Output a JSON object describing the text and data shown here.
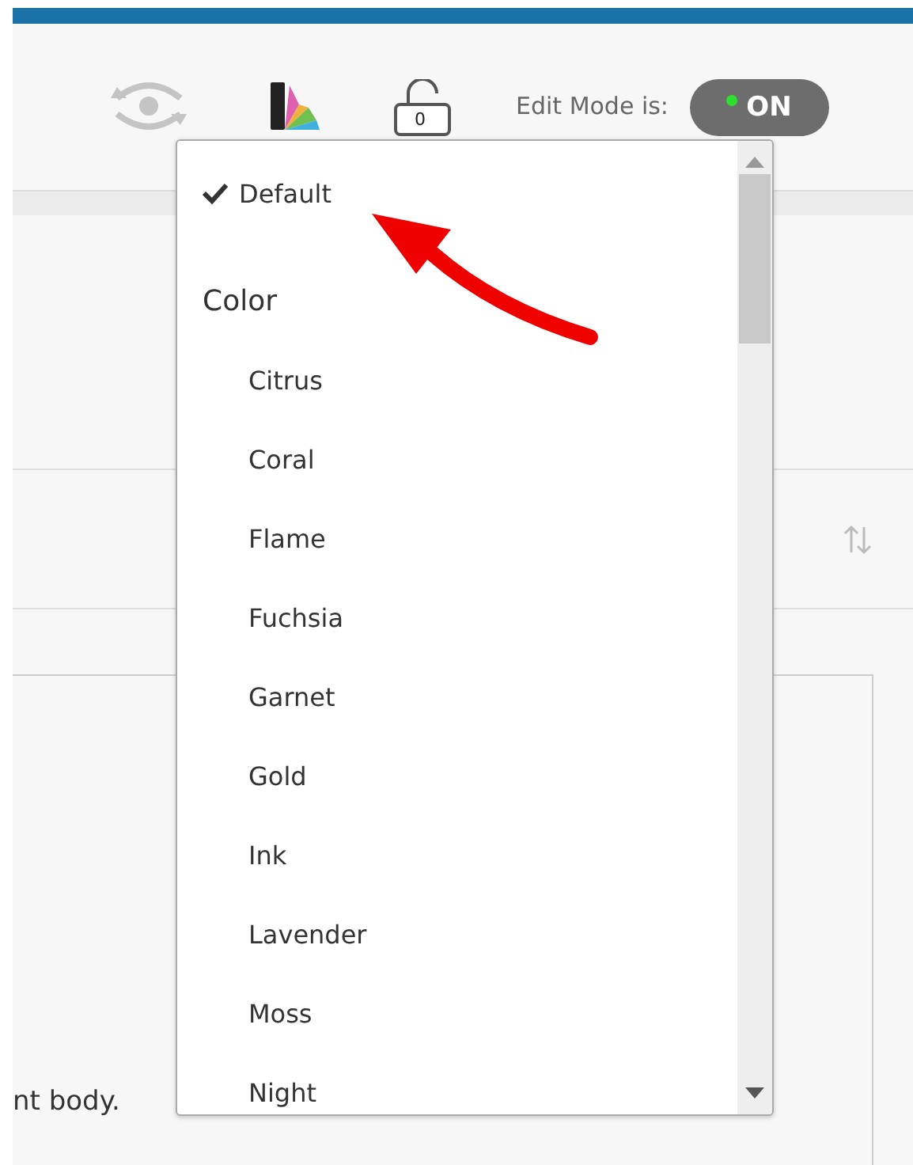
{
  "toolbar": {
    "lock_count": "0",
    "edit_mode_label": "Edit Mode is:",
    "edit_mode_toggle": {
      "label": "ON",
      "on": true
    }
  },
  "theme_dropdown": {
    "items": [
      {
        "kind": "option",
        "label": "Default",
        "selected": true
      },
      {
        "kind": "header",
        "label": "Color"
      },
      {
        "kind": "option",
        "label": "Citrus",
        "selected": false
      },
      {
        "kind": "option",
        "label": "Coral",
        "selected": false
      },
      {
        "kind": "option",
        "label": "Flame",
        "selected": false
      },
      {
        "kind": "option",
        "label": "Fuchsia",
        "selected": false
      },
      {
        "kind": "option",
        "label": "Garnet",
        "selected": false
      },
      {
        "kind": "option",
        "label": "Gold",
        "selected": false
      },
      {
        "kind": "option",
        "label": "Ink",
        "selected": false
      },
      {
        "kind": "option",
        "label": "Lavender",
        "selected": false
      },
      {
        "kind": "option",
        "label": "Moss",
        "selected": false
      },
      {
        "kind": "option",
        "label": "Night",
        "selected": false
      }
    ]
  },
  "content": {
    "body_text": "nt body."
  }
}
